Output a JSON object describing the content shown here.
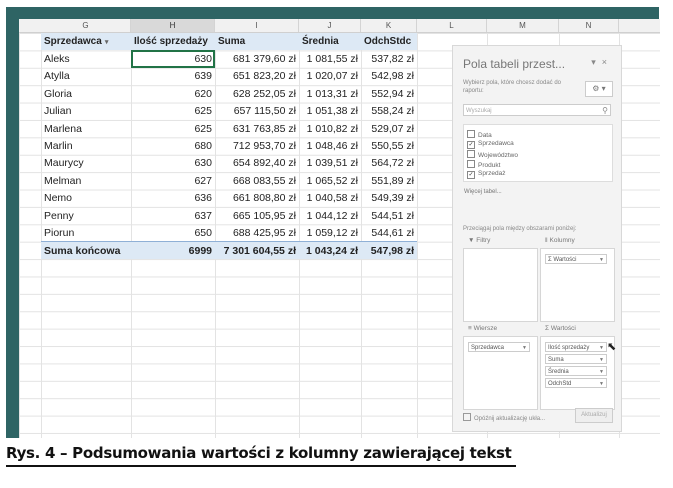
{
  "columns": {
    "G": "G",
    "H": "H",
    "I": "I",
    "J": "J",
    "K": "K",
    "L": "L",
    "M": "M",
    "N": "N"
  },
  "table": {
    "headers": [
      "Sprzedawca",
      "Ilość sprzedaży",
      "Suma",
      "Średnia",
      "OdchStdc"
    ],
    "rows": [
      [
        "Aleks",
        "630",
        "681 379,60 zł",
        "1 081,55 zł",
        "537,82 zł"
      ],
      [
        "Atylla",
        "639",
        "651 823,20 zł",
        "1 020,07 zł",
        "542,98 zł"
      ],
      [
        "Gloria",
        "620",
        "628 252,05 zł",
        "1 013,31 zł",
        "552,94 zł"
      ],
      [
        "Julian",
        "625",
        "657 115,50 zł",
        "1 051,38 zł",
        "558,24 zł"
      ],
      [
        "Marlena",
        "625",
        "631 763,85 zł",
        "1 010,82 zł",
        "529,07 zł"
      ],
      [
        "Marlin",
        "680",
        "712 953,70 zł",
        "1 048,46 zł",
        "550,55 zł"
      ],
      [
        "Maurycy",
        "630",
        "654 892,40 zł",
        "1 039,51 zł",
        "564,72 zł"
      ],
      [
        "Melman",
        "627",
        "668 083,55 zł",
        "1 065,52 zł",
        "551,89 zł"
      ],
      [
        "Nemo",
        "636",
        "661 808,80 zł",
        "1 040,58 zł",
        "549,39 zł"
      ],
      [
        "Penny",
        "637",
        "665 105,95 zł",
        "1 044,12 zł",
        "544,51 zł"
      ],
      [
        "Piorun",
        "650",
        "688 425,95 zł",
        "1 059,12 zł",
        "544,61 zł"
      ]
    ],
    "total": [
      "Suma końcowa",
      "6999",
      "7 301 604,55 zł",
      "1 043,24 zł",
      "547,98 zł"
    ]
  },
  "pane": {
    "title": "Pola tabeli przest...",
    "pin_icon": "▾",
    "close_icon": "×",
    "hint": "Wybierz pola, które chcesz dodać do raportu:",
    "gear_icon": "⚙ ▾",
    "search_placeholder": "Wyszukaj",
    "search_icon": "⚲",
    "fields": [
      {
        "name": "Data",
        "checked": false,
        "mark": ""
      },
      {
        "name": "Sprzedawca",
        "checked": true,
        "mark": "✓"
      },
      {
        "name": "Województwo",
        "checked": false,
        "mark": ""
      },
      {
        "name": "Produkt",
        "checked": false,
        "mark": ""
      },
      {
        "name": "Sprzedaż",
        "checked": true,
        "mark": "✓"
      }
    ],
    "more_tables": "Więcej tabel...",
    "drag_hint": "Przeciągaj pola między obszarami poniżej:",
    "areas": {
      "filters": {
        "label": "▼ Filtry",
        "items": []
      },
      "columns": {
        "label": "‖ Kolumny",
        "items": [
          "Σ Wartości"
        ]
      },
      "rows": {
        "label": "≡ Wiersze",
        "items": [
          "Sprzedawca"
        ]
      },
      "values": {
        "label": "Σ Wartości",
        "items": [
          "Ilość sprzedaży",
          "Suma",
          "Średnia",
          "OdchStd"
        ]
      }
    },
    "defer_label": "Opóźnij aktualizację ukła...",
    "update_button": "Aktualizuj"
  },
  "caption": "Rys. 4 – Podsumowania wartości z kolumny zawierającej tekst"
}
